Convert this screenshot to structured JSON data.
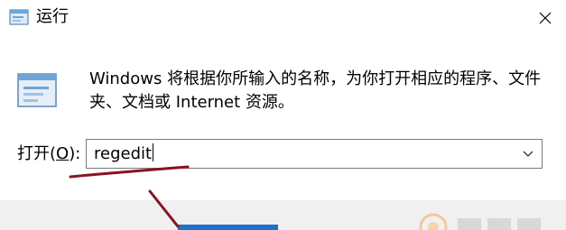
{
  "dialog": {
    "title": "运行",
    "description": "Windows 将根据你所输入的名称，为你打开相应的程序、文件夹、文档或 Internet 资源。",
    "open_label": "打开(",
    "open_hotkey": "O",
    "open_label_end": "):",
    "input_value": "regedit"
  },
  "colors": {
    "annotation_red": "#8b1020",
    "primary_button_blue": "#1e70c8",
    "bottom_bar_bg": "#f0f0f0"
  },
  "icons": {
    "title": "run-app-icon",
    "main": "run-app-icon",
    "close": "close-icon",
    "dropdown": "chevron-down-icon"
  }
}
